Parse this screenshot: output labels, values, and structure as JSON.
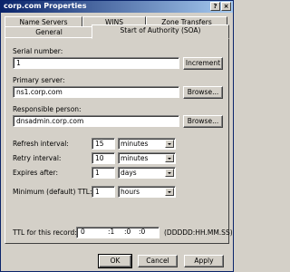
{
  "window": {
    "title": "corp.com Properties",
    "help_glyph": "?",
    "close_glyph": "×"
  },
  "tabs": {
    "row1": [
      "Name Servers",
      "WINS",
      "Zone Transfers"
    ],
    "row2": [
      "General",
      "Start of Authority (SOA)"
    ],
    "active": "Start of Authority (SOA)"
  },
  "soa": {
    "serial_label": "Serial number:",
    "serial_value": "1",
    "increment_label": "Increment",
    "primary_label": "Primary server:",
    "primary_value": "ns1.corp.com",
    "responsible_label": "Responsible person:",
    "responsible_value": "dnsadmin.corp.com",
    "browse_label": "Browse...",
    "refresh_label": "Refresh interval:",
    "refresh_value": "15",
    "refresh_unit": "minutes",
    "retry_label": "Retry interval:",
    "retry_value": "10",
    "retry_unit": "minutes",
    "expires_label": "Expires after:",
    "expires_value": "1",
    "expires_unit": "days",
    "minttl_label": "Minimum (default) TTL:",
    "minttl_value": "1",
    "minttl_unit": "hours",
    "ttl_label": "TTL for this record:",
    "ttl_days": "0",
    "ttl_hours": ":1",
    "ttl_minutes": ":0",
    "ttl_seconds": ":0",
    "ttl_format": "(DDDDD:HH.MM.SS)"
  },
  "buttons": {
    "ok": "OK",
    "cancel": "Cancel",
    "apply": "Apply"
  }
}
